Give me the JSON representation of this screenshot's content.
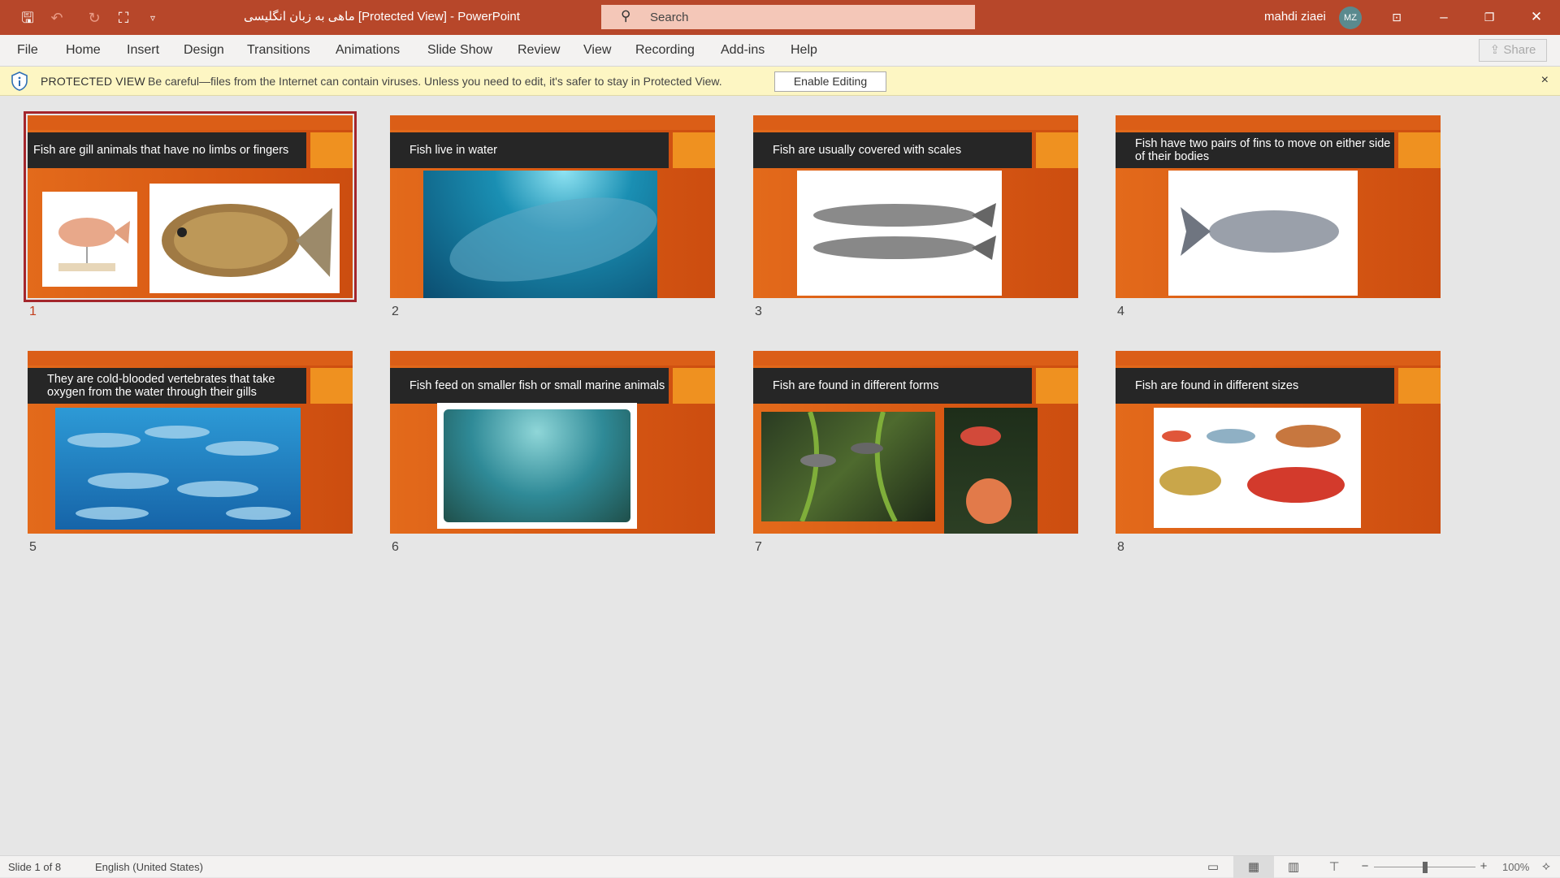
{
  "titlebar": {
    "title": "ماهی به زبان انگلیسی [Protected View]  -  PowerPoint",
    "search_placeholder": "Search",
    "user": "mahdi ziaei",
    "avatar": "MZ"
  },
  "ribbon": {
    "tabs": [
      "File",
      "Home",
      "Insert",
      "Design",
      "Transitions",
      "Animations",
      "Slide Show",
      "Review",
      "View",
      "Recording",
      "Add-ins",
      "Help"
    ],
    "share": "Share"
  },
  "protected_view": {
    "label": "PROTECTED VIEW",
    "message": "Be careful—files from the Internet can contain viruses. Unless you need to edit, it's safer to stay in Protected View.",
    "button": "Enable Editing",
    "close": "×"
  },
  "slides": [
    {
      "number": "1",
      "title": "Fish are gill animals that have no limbs or fingers"
    },
    {
      "number": "2",
      "title": "Fish live in water"
    },
    {
      "number": "3",
      "title": "Fish are usually covered with scales"
    },
    {
      "number": "4",
      "title": "Fish have two pairs of fins to move on either side of their bodies"
    },
    {
      "number": "5",
      "title": "They are cold-blooded vertebrates that take oxygen from the water through their gills"
    },
    {
      "number": "6",
      "title": "Fish feed on smaller fish or small marine animals"
    },
    {
      "number": "7",
      "title": "Fish are found in different forms"
    },
    {
      "number": "8",
      "title": "Fish are found in different sizes"
    }
  ],
  "status": {
    "slide": "Slide 1 of 8",
    "language": "English (United States)",
    "zoom": "100%",
    "zoom_level_percent": 100
  },
  "colors": {
    "titlebar": "#b7472a",
    "accent": "#e36a1b",
    "selected": "#a4262c"
  }
}
